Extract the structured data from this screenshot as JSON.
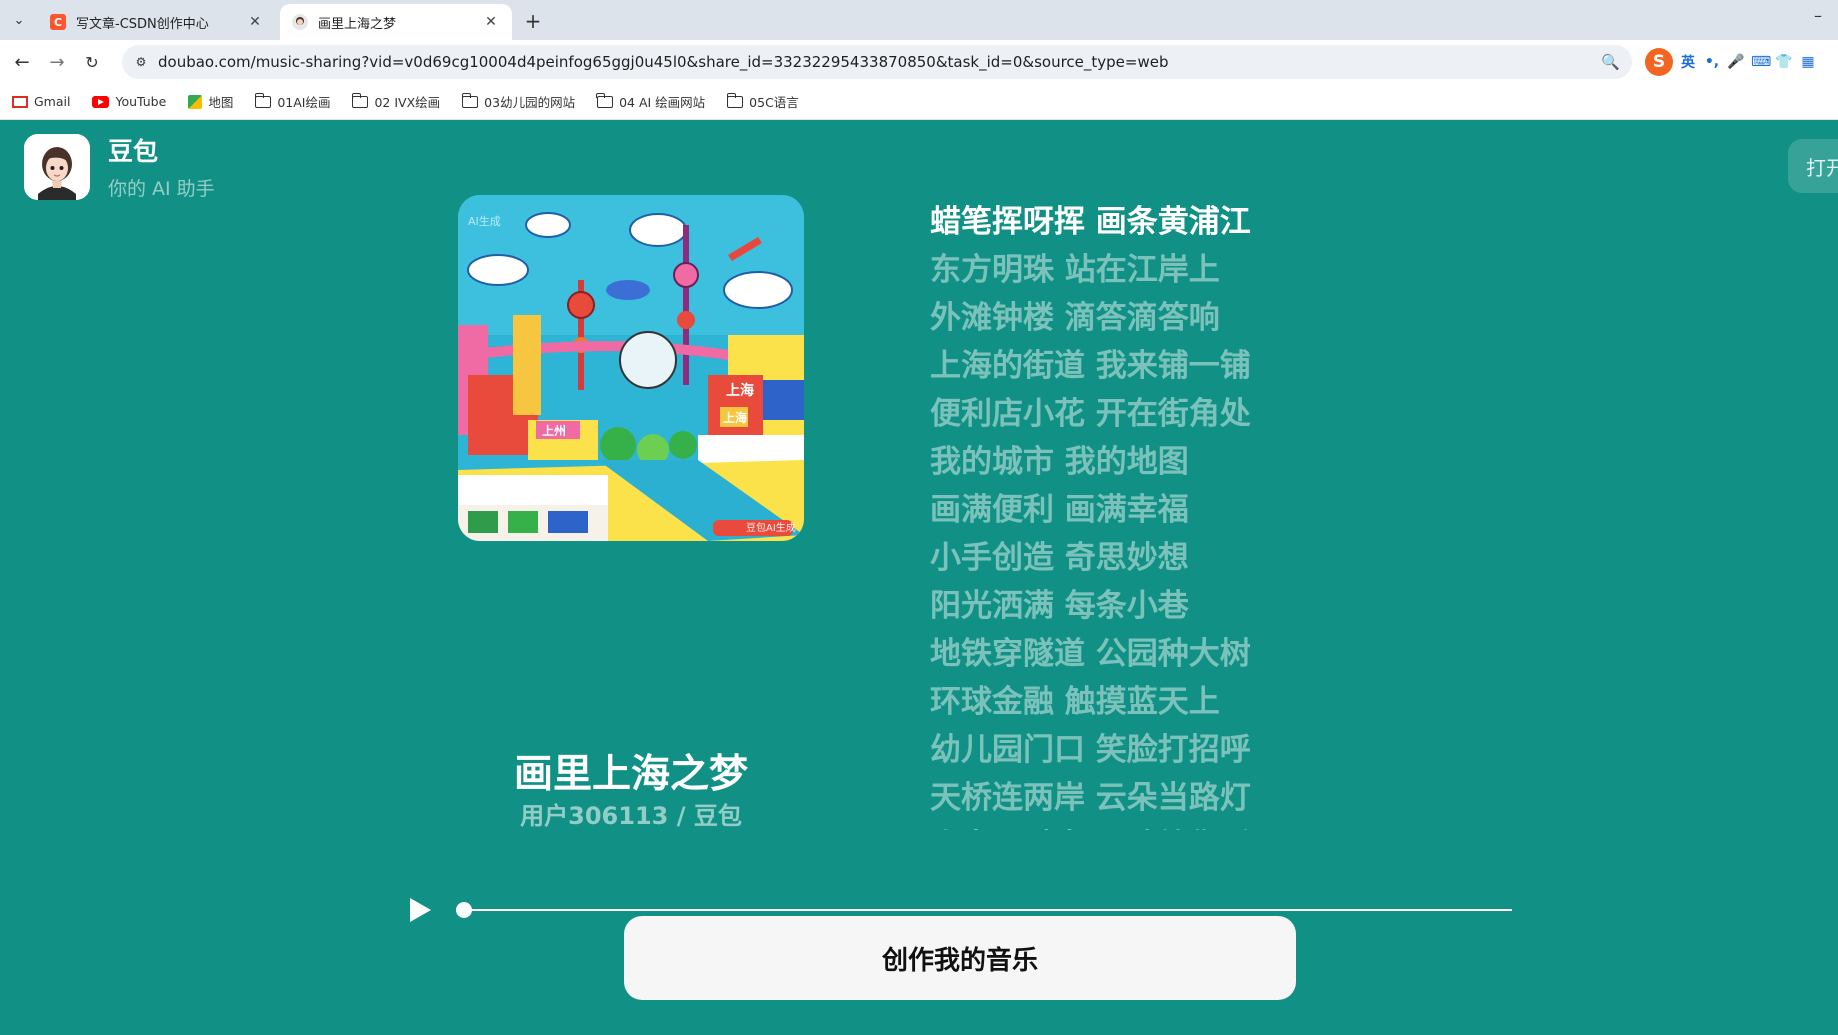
{
  "browser": {
    "tabs": [
      {
        "title": "写文章-CSDN创作中心",
        "favicon": "csdn-icon",
        "active": false
      },
      {
        "title": "画里上海之梦",
        "favicon": "doubao-icon",
        "active": true
      }
    ],
    "close_glyph": "✕",
    "new_tab_glyph": "+",
    "minimize_glyph": "–",
    "url": "doubao.com/music-sharing?vid=v0d69cg10004d4peinfog65ggj0u45l0&share_id=33232295433870850&task_id=0&source_type=web",
    "ime": {
      "logo": "S",
      "items": [
        "英",
        "•,",
        "🎤",
        "⌨",
        "👕",
        "▦"
      ]
    },
    "bookmarks": [
      {
        "label": "Gmail",
        "icon": "gmail-icon"
      },
      {
        "label": "YouTube",
        "icon": "youtube-icon"
      },
      {
        "label": "地图",
        "icon": "maps-icon"
      },
      {
        "label": "01AI绘画",
        "icon": "folder-icon"
      },
      {
        "label": "02 IVX绘画",
        "icon": "folder-icon"
      },
      {
        "label": "03幼儿园的网站",
        "icon": "folder-icon"
      },
      {
        "label": "04 AI 绘画网站",
        "icon": "folder-icon"
      },
      {
        "label": "05C语言",
        "icon": "folder-icon"
      }
    ]
  },
  "header": {
    "brand_name": "豆包",
    "brand_subtitle": "你的 AI 助手",
    "open_button_label": "打开"
  },
  "song": {
    "title": "画里上海之梦",
    "meta": "用户306113 / 豆包",
    "cover_watermark_top": "AI生成",
    "cover_watermark_bottom": "豆包AI生成",
    "cover_sign_1": "上海",
    "cover_sign_2": "上海",
    "cover_sign_3": "上州"
  },
  "lyrics": {
    "current_index": 0,
    "lines": [
      "蜡笔挥呀挥 画条黄浦江",
      "东方明珠 站在江岸上",
      "外滩钟楼 滴答滴答响",
      "上海的街道 我来铺一铺",
      "便利店小花 开在街角处",
      "我的城市 我的地图",
      "画满便利 画满幸福",
      "小手创造 奇思妙想",
      "阳光洒满 每条小巷",
      "地铁穿隧道 公园种大树",
      "环球金融 触摸蓝天上",
      "幼儿园门口 笑脸打招呼",
      "天桥连两岸 云朵当路灯",
      "小鸟飞过来 唱歌给你听"
    ]
  },
  "player": {
    "progress": 0.0,
    "play_icon": "play-icon"
  },
  "cta": {
    "label": "创作我的音乐"
  },
  "colors": {
    "page_bg": "#119185",
    "lyric_current": "#ffffff",
    "lyric_dim": "rgba(255,255,255,0.45)",
    "cta_bg": "#f6f6f6"
  }
}
